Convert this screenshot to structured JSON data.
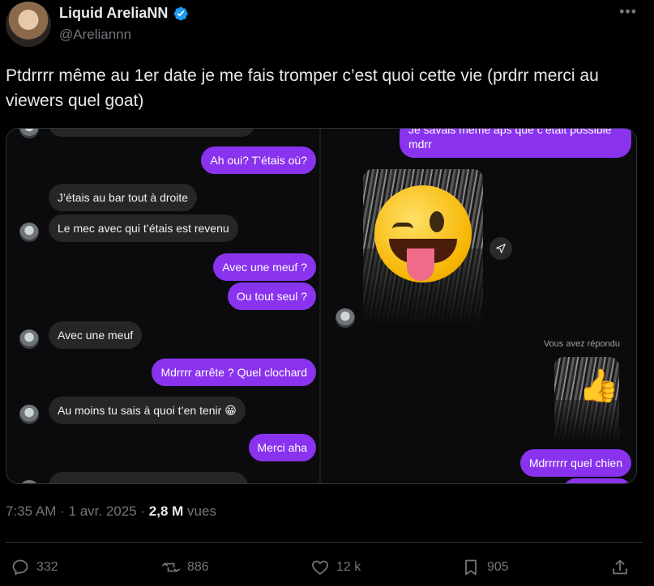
{
  "author": {
    "display_name": "Liquid AreliaNN",
    "handle": "@Areliannn",
    "verified_icon": "verified-badge-icon",
    "more_label": "•••"
  },
  "tweet": {
    "text": "Ptdrrrr même au 1er date je me fais tromper c’est quoi cette vie (prdrr merci au viewers quel goat)"
  },
  "media": {
    "left_panel": {
      "messages": [
        {
          "side": "sent",
          "text": "Ah oui? T’étais où?"
        },
        {
          "side": "received",
          "text": "J’étais au bar tout à droite"
        },
        {
          "side": "received",
          "text": "Le mec avec qui t’étais est revenu"
        },
        {
          "side": "sent",
          "text": "Avec une meuf ?"
        },
        {
          "side": "sent",
          "text": "Ou tout seul ?"
        },
        {
          "side": "received",
          "text": "Avec une meuf"
        },
        {
          "side": "sent",
          "text": "Mdrrrr arrête ? Quel clochard"
        },
        {
          "side": "received",
          "text": "Au moins tu sais à quoi t’en tenir 😁"
        },
        {
          "side": "sent",
          "text": "Merci aha"
        }
      ]
    },
    "right_panel": {
      "top_message": "Je savais même aps que c’était possible mdrr",
      "replied_label": "Vous avez répondu",
      "last_message": "Mdrrrrrr quel chien",
      "photo_emoji": "winking-tongue-emoji",
      "thumb_emoji": "👍"
    }
  },
  "meta": {
    "time": "7:35 AM",
    "sep1": "·",
    "date": "1 avr. 2025",
    "sep2": "·",
    "views_count": "2,8 M",
    "views_label": "vues"
  },
  "actions": {
    "replies": "332",
    "reposts": "886",
    "likes": "12 k",
    "bookmarks": "905"
  },
  "colors": {
    "background": "#000000",
    "sent_bubble": "#8a33ef",
    "received_bubble": "#262628",
    "muted": "#71767b",
    "verified": "#1d9bf0"
  }
}
